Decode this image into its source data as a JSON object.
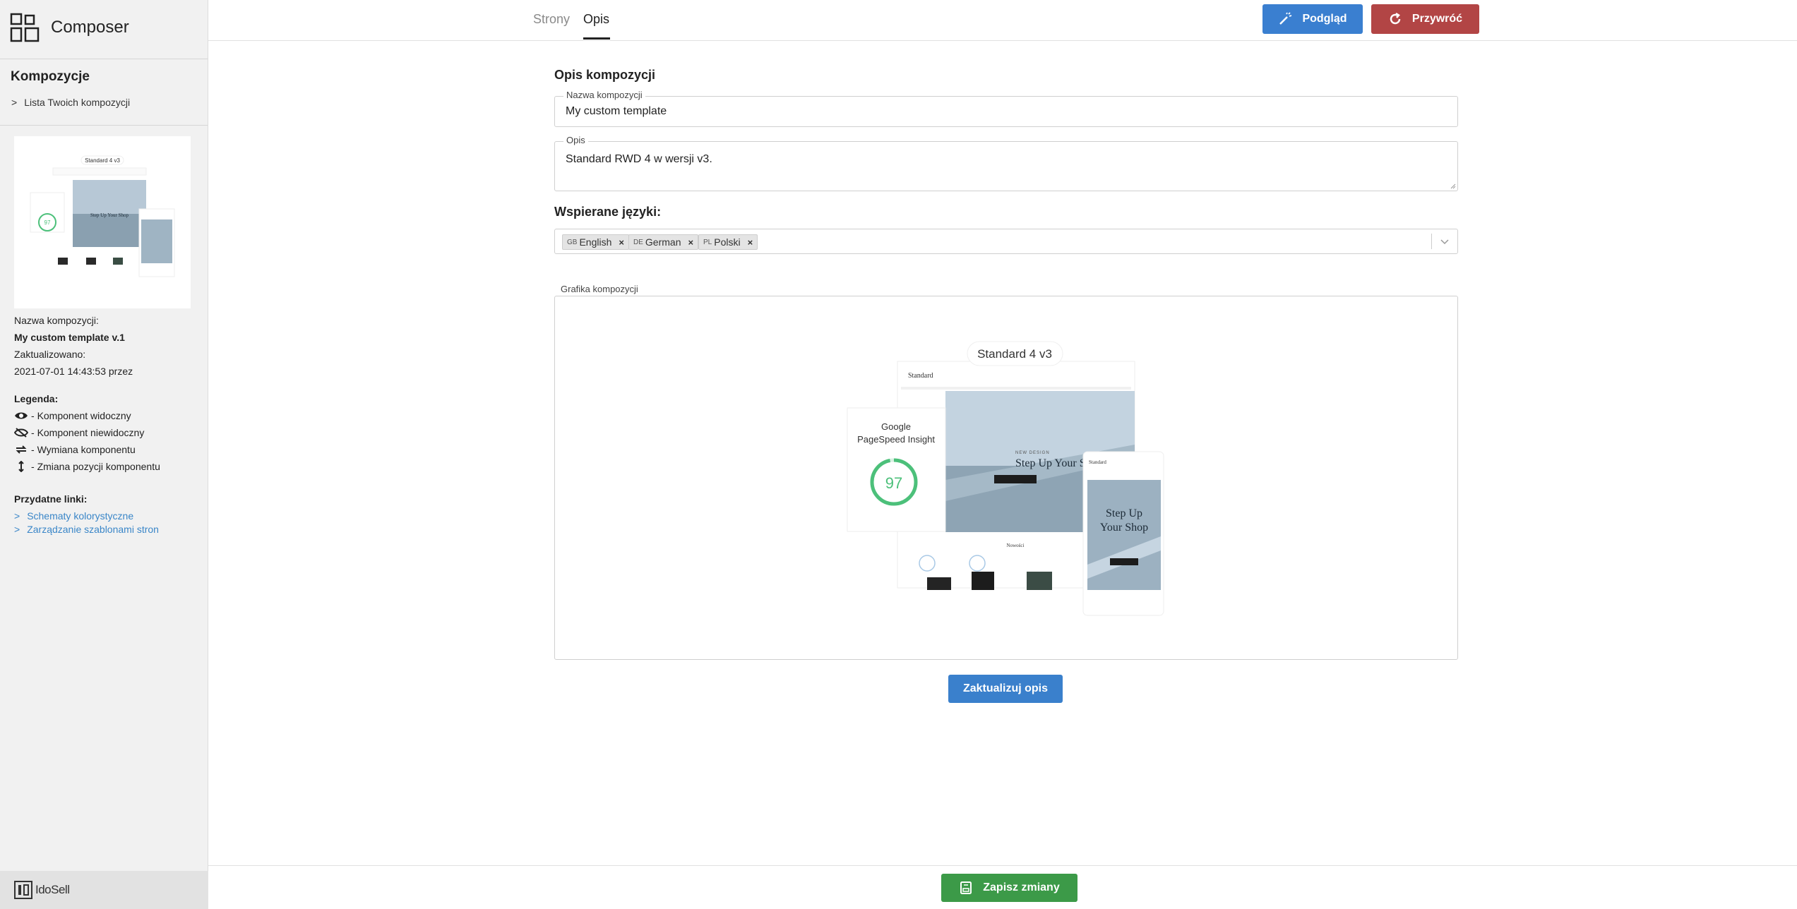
{
  "app": {
    "title": "Composer"
  },
  "sidebar": {
    "heading": "Kompozycje",
    "list_link": "Lista Twoich kompozycji",
    "thumbnail": {
      "title": "Standard 4 v3",
      "score": "97"
    },
    "name_label": "Nazwa kompozycji:",
    "name_value": "My custom template v.1",
    "updated_label": "Zaktualizowano:",
    "updated_value": "2021-07-01 14:43:53 przez",
    "legend_title": "Legenda:",
    "legend": [
      {
        "icon": "eye-icon",
        "label": "Komponent widoczny"
      },
      {
        "icon": "eye-slash-icon",
        "label": "Komponent niewidoczny"
      },
      {
        "icon": "swap-icon",
        "label": "Wymiana komponentu"
      },
      {
        "icon": "vertical-arrows-icon",
        "label": "Zmiana pozycji komponentu"
      }
    ],
    "links_title": "Przydatne linki:",
    "links": [
      "Schematy kolorystyczne",
      "Zarządzanie szablonami stron"
    ],
    "footer_brand": "IdoSell"
  },
  "topbar": {
    "tabs": [
      "Strony",
      "Opis"
    ],
    "active_tab": "Opis",
    "preview_label": "Podgląd",
    "restore_label": "Przywróć"
  },
  "form": {
    "section_title": "Opis kompozycji",
    "name_legend": "Nazwa kompozycji",
    "name_value": "My custom template",
    "desc_legend": "Opis",
    "desc_value": "Standard RWD 4 w wersji v3.",
    "languages_title": "Wspierane języki:",
    "languages": [
      {
        "flag": "GB",
        "name": "English"
      },
      {
        "flag": "DE",
        "name": "German"
      },
      {
        "flag": "PL",
        "name": "Polski"
      }
    ],
    "graphic_legend": "Grafika kompozycji",
    "update_label": "Zaktualizuj opis"
  },
  "preview_image": {
    "title": "Standard 4 v3",
    "brand": "Standard",
    "pagespeed_line1": "Google",
    "pagespeed_line2": "PageSpeed Insight",
    "score": "97",
    "hero_kicker": "NEW DESIGN",
    "hero_title": "Step Up Your Shop",
    "mobile_title_1": "Step Up",
    "mobile_title_2": "Your Shop",
    "section_label": "Nowości"
  },
  "footer": {
    "save_label": "Zapisz zmiany"
  },
  "colors": {
    "primary": "#3a7fd0",
    "danger": "#b24545",
    "success": "#3c9a48",
    "link": "#3a86c8",
    "score": "#4cc07a"
  }
}
